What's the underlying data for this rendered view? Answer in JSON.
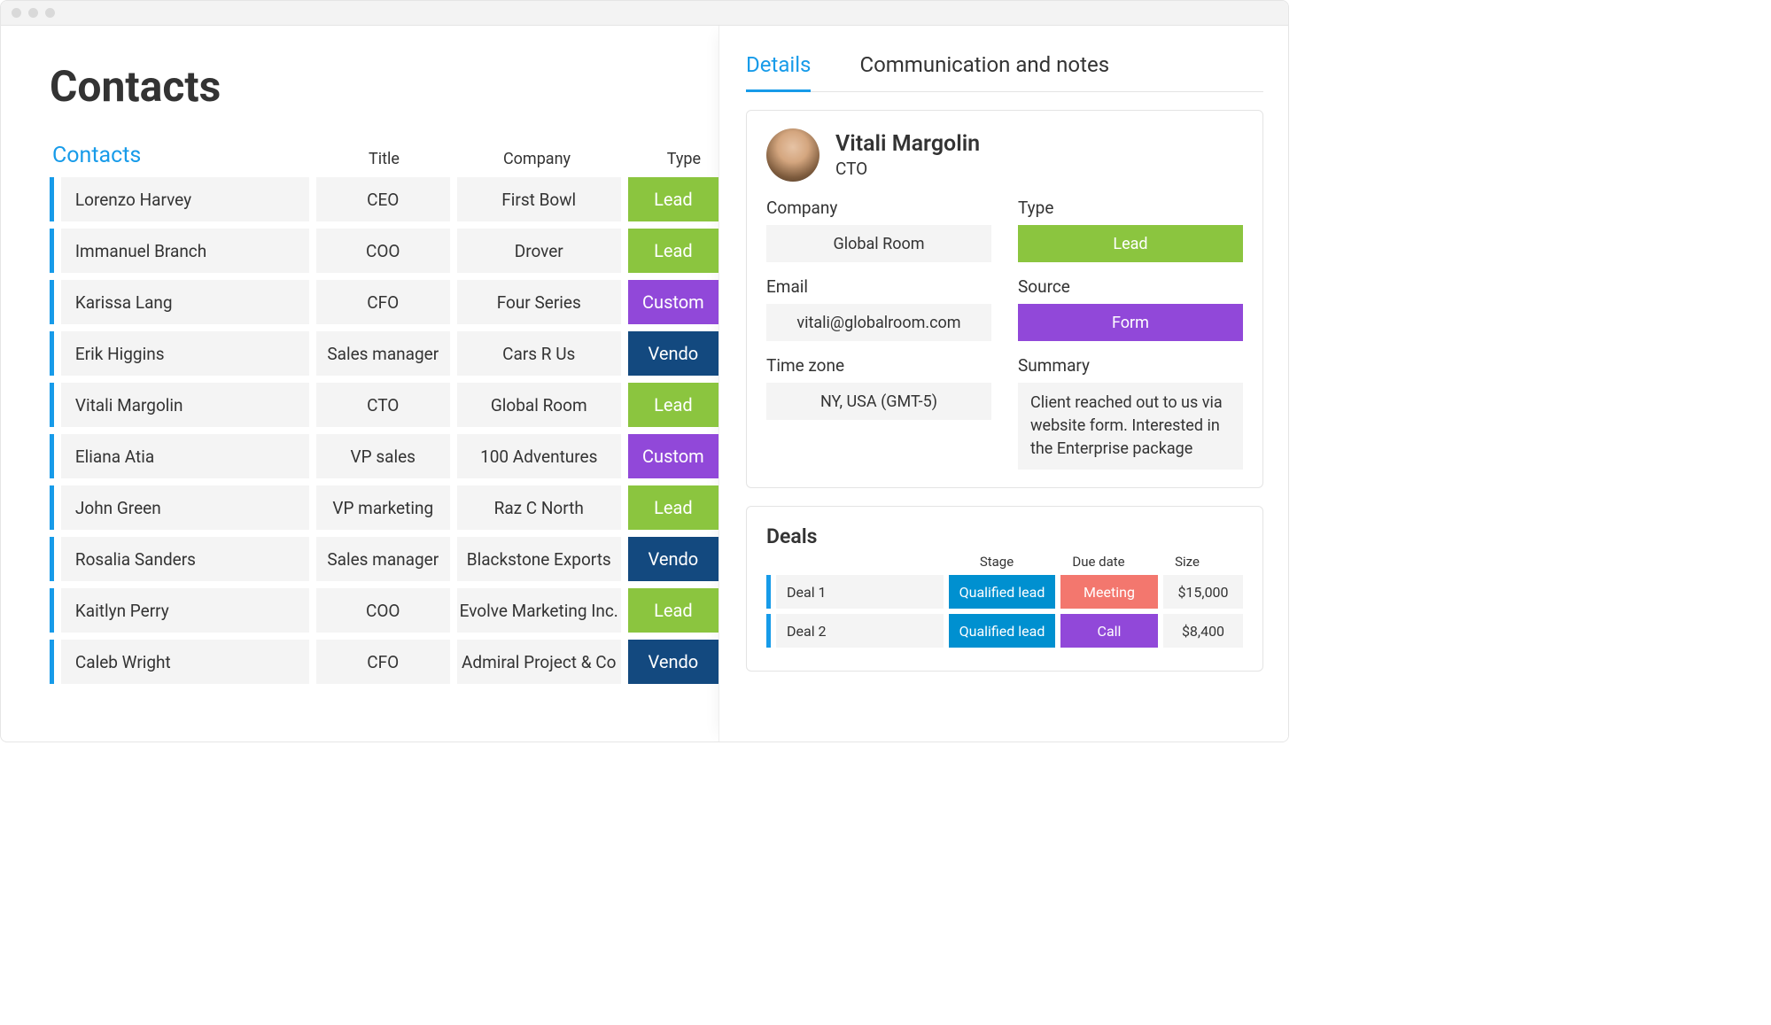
{
  "page": {
    "title": "Contacts"
  },
  "contacts_table": {
    "heading": "Contacts",
    "columns": {
      "title": "Title",
      "company": "Company",
      "type": "Type"
    },
    "rows": [
      {
        "name": "Lorenzo Harvey",
        "title": "CEO",
        "company": "First Bowl",
        "type": "Lead",
        "type_class": "type-lead"
      },
      {
        "name": "Immanuel Branch",
        "title": "COO",
        "company": "Drover",
        "type": "Lead",
        "type_class": "type-lead"
      },
      {
        "name": "Karissa Lang",
        "title": "CFO",
        "company": "Four Series",
        "type": "Custom",
        "type_class": "type-customer"
      },
      {
        "name": "Erik Higgins",
        "title": "Sales manager",
        "company": "Cars R Us",
        "type": "Vendo",
        "type_class": "type-vendor"
      },
      {
        "name": "Vitali Margolin",
        "title": "CTO",
        "company": "Global Room",
        "type": "Lead",
        "type_class": "type-lead"
      },
      {
        "name": "Eliana Atia",
        "title": "VP sales",
        "company": "100 Adventures",
        "type": "Custom",
        "type_class": "type-customer"
      },
      {
        "name": "John Green",
        "title": "VP marketing",
        "company": "Raz C North",
        "type": "Lead",
        "type_class": "type-lead"
      },
      {
        "name": "Rosalia Sanders",
        "title": "Sales manager",
        "company": "Blackstone Exports",
        "type": "Vendo",
        "type_class": "type-vendor"
      },
      {
        "name": "Kaitlyn Perry",
        "title": "COO",
        "company": "Evolve Marketing Inc.",
        "type": "Lead",
        "type_class": "type-lead"
      },
      {
        "name": "Caleb Wright",
        "title": "CFO",
        "company": "Admiral Project & Co",
        "type": "Vendo",
        "type_class": "type-vendor"
      }
    ]
  },
  "tabs": {
    "details": "Details",
    "communication": "Communication and notes"
  },
  "profile": {
    "name": "Vitali Margolin",
    "title": "CTO",
    "fields": {
      "company_label": "Company",
      "company_value": "Global Room",
      "type_label": "Type",
      "type_value": "Lead",
      "email_label": "Email",
      "email_value": "vitali@globalroom.com",
      "source_label": "Source",
      "source_value": "Form",
      "timezone_label": "Time zone",
      "timezone_value": "NY, USA (GMT-5)",
      "summary_label": "Summary",
      "summary_value": "Client reached out to us via website form. Interested in the Enterprise package"
    }
  },
  "deals": {
    "title": "Deals",
    "columns": {
      "stage": "Stage",
      "due": "Due date",
      "size": "Size"
    },
    "rows": [
      {
        "name": "Deal 1",
        "stage": "Qualified lead",
        "stage_class": "stage-qualified",
        "due": "Meeting",
        "due_class": "due-meeting",
        "size": "$15,000"
      },
      {
        "name": "Deal 2",
        "stage": "Qualified lead",
        "stage_class": "stage-qualified",
        "due": "Call",
        "due_class": "due-call",
        "size": "$8,400"
      }
    ]
  }
}
